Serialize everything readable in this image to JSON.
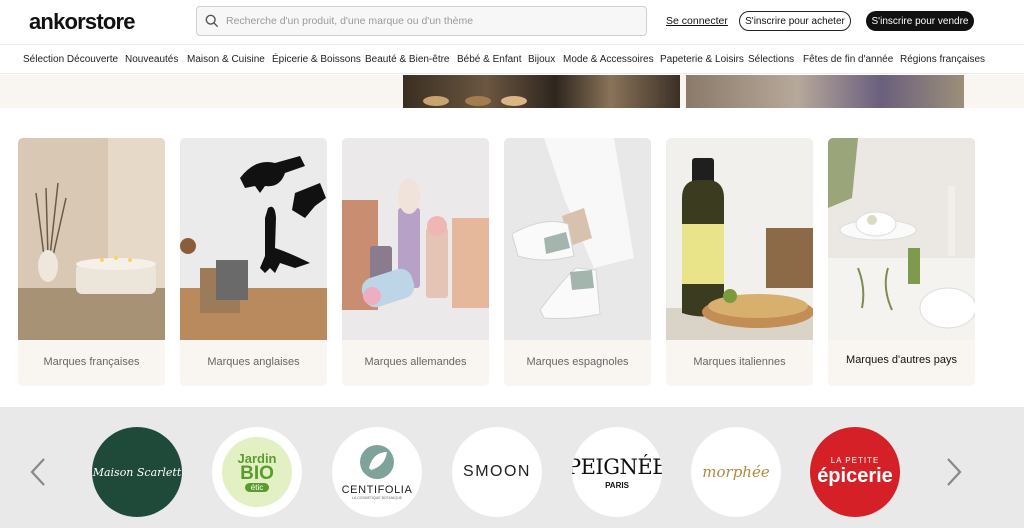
{
  "header": {
    "logo": "ankorstore",
    "search_placeholder": "Recherche d'un produit, d'une marque ou d'un thème",
    "login": "Se connecter",
    "signup_buy": "S'inscrire pour acheter",
    "signup_sell": "S'inscrire pour vendre"
  },
  "nav": {
    "items": [
      "Sélection Découverte",
      "Nouveautés",
      "Maison & Cuisine",
      "Épicerie & Boissons",
      "Beauté & Bien-être",
      "Bébé & Enfant",
      "Bijoux",
      "Mode & Accessoires",
      "Papeterie & Loisirs",
      "Sélections",
      "Fêtes de fin d'année",
      "Régions françaises"
    ]
  },
  "countries": [
    {
      "label": "Marques françaises"
    },
    {
      "label": "Marques anglaises"
    },
    {
      "label": "Marques allemandes"
    },
    {
      "label": "Marques espagnoles"
    },
    {
      "label": "Marques italiennes"
    },
    {
      "label": "Marques d'autres pays"
    }
  ],
  "brands": {
    "items": [
      {
        "name": "Maison Scarlett",
        "bg": "#1f4a3a",
        "color": "#ffffff"
      },
      {
        "name": "Jardin BIO étic",
        "bg": "#ffffff",
        "color": "#5a9b2e",
        "sub": "Jardin",
        "main": "BIO",
        "tag": "étic"
      },
      {
        "name": "CENTIFOLIA",
        "bg": "#ffffff",
        "color": "#222222",
        "tagline": "LA COSMETIQUE BOTANIQUE"
      },
      {
        "name": "SMOON",
        "bg": "#ffffff",
        "color": "#222222"
      },
      {
        "name": "PEIGNÉE",
        "bg": "#ffffff",
        "color": "#111111",
        "city": "PARIS"
      },
      {
        "name": "morphée",
        "bg": "#ffffff",
        "color": "#b08a3e"
      },
      {
        "name": "LA PETITE épicerie",
        "bg": "#d42026",
        "color": "#ffffff",
        "top": "LA PETITE",
        "main": "épicerie"
      }
    ]
  },
  "colors": {
    "accent": "#111111",
    "card_bg": "#f9f6f1",
    "carousel_bg": "#e9e9e9"
  }
}
